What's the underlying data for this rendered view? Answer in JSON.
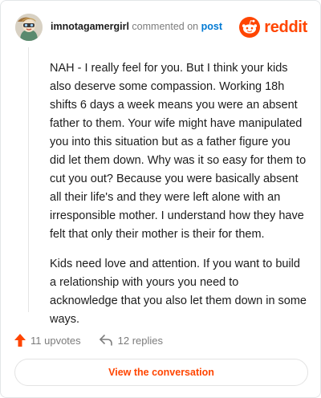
{
  "comment": {
    "username": "imnotagamergirl",
    "commented_on": "commented on",
    "post_link": "post",
    "paragraphs": [
      "NAH - I really feel for you. But I think your kids also deserve some compassion. Working 18h shifts 6 days a week means you were an absent father to them. Your wife might have manipulated you into this situation but as a father figure you did let them down. Why was it so easy for them to cut you out? Because you were basically absent all their life's and they were left alone with an irresponsible mother. I understand how they have felt that only their mother is their for them.",
      "Kids need love and attention. If you want to build a relationship with yours you need to acknowledge that you also let them down in some ways."
    ]
  },
  "brand": {
    "wordmark": "reddit",
    "icon": "reddit-snoo-icon",
    "color": "#ff4500"
  },
  "actions": {
    "upvotes": "11 upvotes",
    "replies": "12 replies",
    "upvote_icon": "upvote-arrow-icon",
    "reply_icon": "reply-arrow-icon",
    "upvote_color": "#ff4500"
  },
  "footer": {
    "view_button": "View the conversation"
  }
}
